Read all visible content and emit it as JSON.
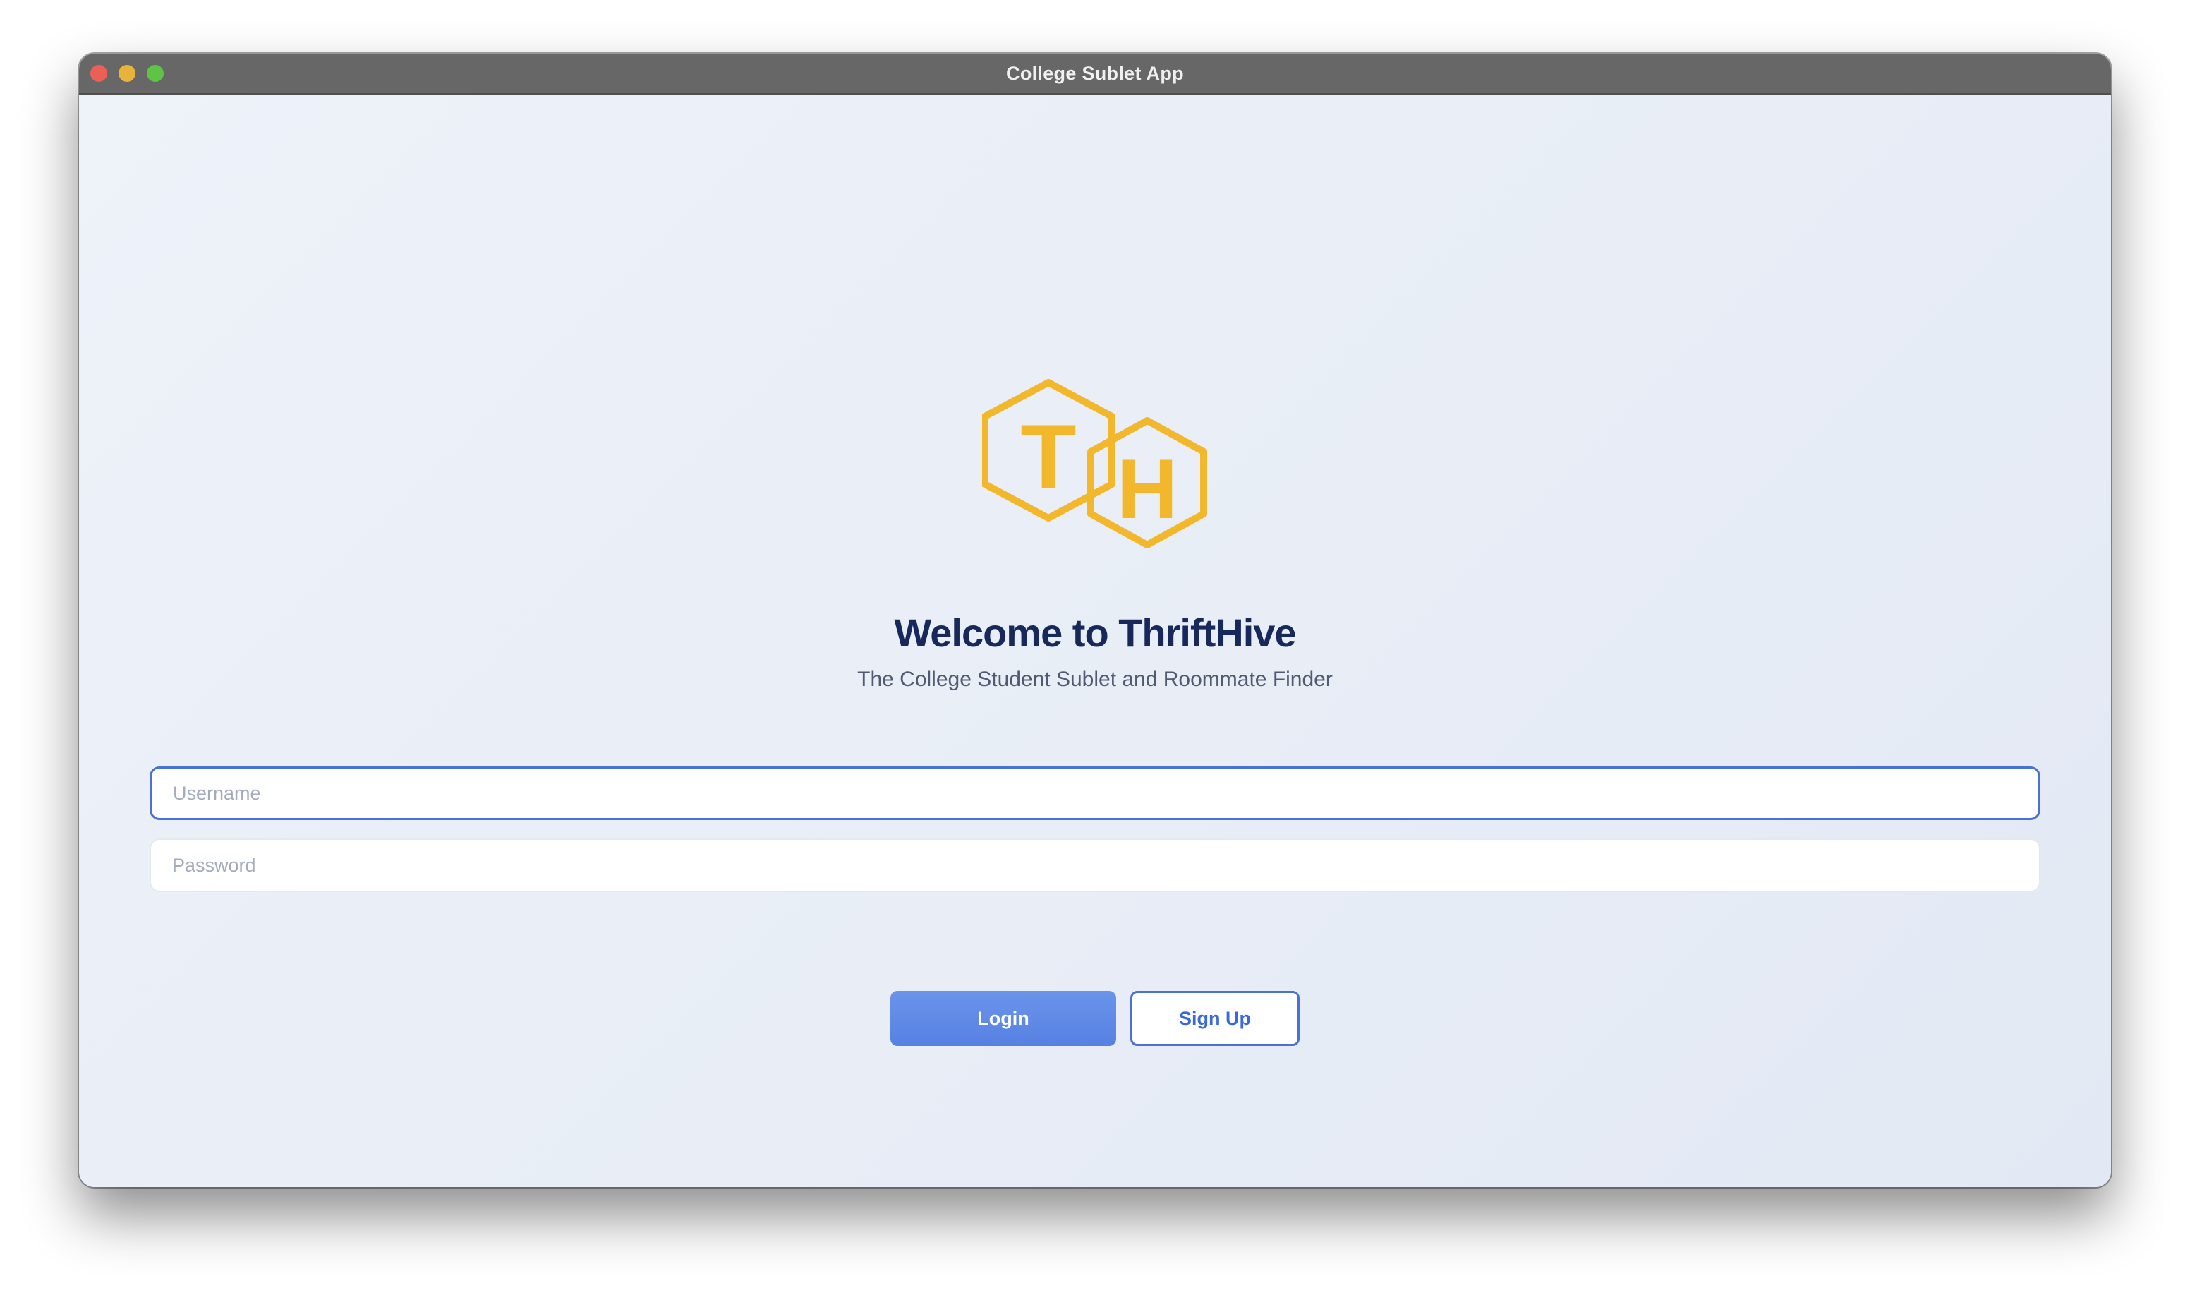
{
  "window": {
    "title": "College Sublet App"
  },
  "logo": {
    "letter_left": "T",
    "letter_right": "H",
    "color": "#f2b72b"
  },
  "welcome": {
    "heading": "Welcome to ThriftHive",
    "subtitle": "The College Student Sublet and Roommate Finder"
  },
  "form": {
    "username_placeholder": "Username",
    "username_value": "",
    "password_placeholder": "Password",
    "password_value": ""
  },
  "buttons": {
    "login_label": "Login",
    "signup_label": "Sign Up"
  },
  "colors": {
    "accent": "#4a72d6",
    "heading": "#17285a"
  }
}
